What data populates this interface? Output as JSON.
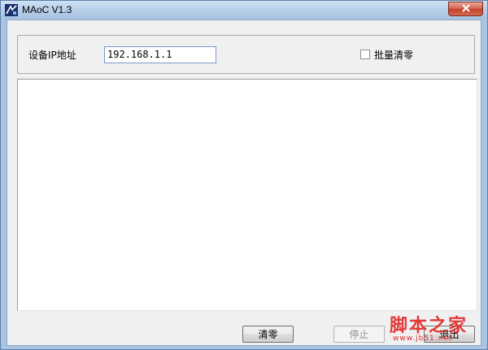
{
  "window": {
    "title": "MAoC V1.3"
  },
  "device": {
    "ip_label": "设备IP地址",
    "ip_value": "192.168.1.1",
    "batch_clear_label": "批量清零",
    "batch_clear_checked": false
  },
  "log": {
    "lines": []
  },
  "buttons": {
    "clear_label": "清零",
    "stop_label": "停止",
    "stop_enabled": false,
    "exit_label": "退出"
  },
  "watermark": {
    "text": "脚本之家",
    "sub": "www.jb51.net"
  },
  "icons": {
    "app": "app-logo-icon",
    "close": "close-icon"
  },
  "colors": {
    "titlebar": "#b9d0ea",
    "close": "#c2412a",
    "client": "#f0f0f0",
    "watermark": "#e02626"
  }
}
